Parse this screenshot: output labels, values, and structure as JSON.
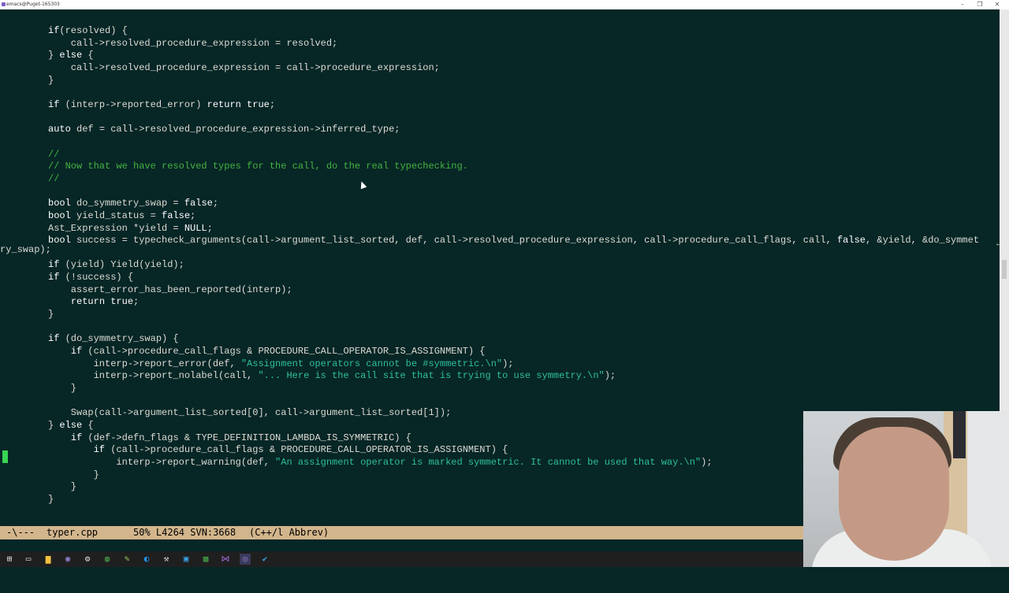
{
  "window": {
    "title": "emacs@Puget-165303",
    "controls": {
      "minimize": "–",
      "maximize": "❐",
      "close": "✕"
    }
  },
  "editor": {
    "code_lines": [
      [
        [
          "kw",
          "if"
        ],
        [
          "",
          "(resolved) {"
        ]
      ],
      [
        [
          "",
          "    call->resolved_procedure_expression = resolved;"
        ]
      ],
      [
        [
          "",
          "} "
        ],
        [
          "kw",
          "else"
        ],
        [
          "",
          " {"
        ]
      ],
      [
        [
          "",
          "    call->resolved_procedure_expression = call->procedure_expression;"
        ]
      ],
      [
        [
          "",
          "}"
        ]
      ],
      [
        [
          "",
          ""
        ]
      ],
      [
        [
          "kw",
          "if"
        ],
        [
          "",
          " (interp->reported_error) "
        ],
        [
          "kw",
          "return true"
        ],
        [
          "",
          ";"
        ]
      ],
      [
        [
          "",
          ""
        ]
      ],
      [
        [
          "kw",
          "auto"
        ],
        [
          "",
          " def = call->resolved_procedure_expression->inferred_type;"
        ]
      ],
      [
        [
          "",
          ""
        ]
      ],
      [
        [
          "cm",
          "//"
        ]
      ],
      [
        [
          "cm",
          "// Now that we have resolved types for the call, do the real typechecking."
        ]
      ],
      [
        [
          "cm",
          "//"
        ]
      ],
      [
        [
          "",
          ""
        ]
      ],
      [
        [
          "kw",
          "bool"
        ],
        [
          "",
          " do_symmetry_swap = "
        ],
        [
          "kw",
          "false"
        ],
        [
          "",
          ";"
        ]
      ],
      [
        [
          "kw",
          "bool"
        ],
        [
          "",
          " yield_status = "
        ],
        [
          "kw",
          "false"
        ],
        [
          "",
          ";"
        ]
      ],
      [
        [
          "",
          "Ast_Expression *yield = "
        ],
        [
          "kw",
          "NULL"
        ],
        [
          "",
          ";"
        ]
      ],
      [
        [
          "kw",
          "bool"
        ],
        [
          "",
          " success = typecheck_arguments(call->argument_list_sorted, def, call->resolved_procedure_expression, call->procedure_call_flags, call, "
        ],
        [
          "kw",
          "false"
        ],
        [
          "",
          ", &yield, &do_symmet"
        ]
      ],
      [
        [
          "",
          ""
        ]
      ],
      [
        [
          "kw",
          "if"
        ],
        [
          "",
          " (yield) Yield(yield);"
        ]
      ],
      [
        [
          "kw",
          "if"
        ],
        [
          "",
          " (!success) {"
        ]
      ],
      [
        [
          "",
          "    assert_error_has_been_reported(interp);"
        ]
      ],
      [
        [
          "",
          "    "
        ],
        [
          "kw",
          "return true"
        ],
        [
          "",
          ";"
        ]
      ],
      [
        [
          "",
          "}"
        ]
      ],
      [
        [
          "",
          ""
        ]
      ],
      [
        [
          "kw",
          "if"
        ],
        [
          "",
          " (do_symmetry_swap) {"
        ]
      ],
      [
        [
          "",
          "    "
        ],
        [
          "kw",
          "if"
        ],
        [
          "",
          " (call->procedure_call_flags & PROCEDURE_CALL_OPERATOR_IS_ASSIGNMENT) {"
        ]
      ],
      [
        [
          "",
          "        interp->report_error(def, "
        ],
        [
          "str",
          "\"Assignment operators cannot be #symmetric.\\n\""
        ],
        [
          "",
          ");"
        ]
      ],
      [
        [
          "",
          "        interp->report_nolabel(call, "
        ],
        [
          "str",
          "\"... Here is the call site that is trying to use symmetry.\\n\""
        ],
        [
          "",
          ");"
        ]
      ],
      [
        [
          "",
          "    }"
        ]
      ],
      [
        [
          "",
          ""
        ]
      ],
      [
        [
          "",
          "    Swap(call->argument_list_sorted[0], call->argument_list_sorted[1]);"
        ]
      ],
      [
        [
          "",
          "} "
        ],
        [
          "kw",
          "else"
        ],
        [
          "",
          " {"
        ]
      ],
      [
        [
          "",
          "    "
        ],
        [
          "kw",
          "if"
        ],
        [
          "",
          " (def->defn_flags & TYPE_DEFINITION_LAMBDA_IS_SYMMETRIC) {"
        ]
      ],
      [
        [
          "",
          "        "
        ],
        [
          "kw",
          "if"
        ],
        [
          "",
          " (call->procedure_call_flags & PROCEDURE_CALL_OPERATOR_IS_ASSIGNMENT) {"
        ]
      ],
      [
        [
          "",
          "            interp->report_warning(def, "
        ],
        [
          "str",
          "\"An assignment operator is marked symmetric. It cannot be used that way.\\n\""
        ],
        [
          "",
          ");"
        ]
      ],
      [
        [
          "",
          "        }"
        ]
      ],
      [
        [
          "",
          "    }"
        ]
      ],
      [
        [
          "",
          "}"
        ]
      ]
    ],
    "wrapped_line": "ry_swap);",
    "continuation_glyph": "↵"
  },
  "modeline": {
    "state": "-\\---",
    "buffer_name": "typer.cpp",
    "position": "50% L4264 SVN:3668",
    "modes": "(C++/l Abbrev)"
  },
  "taskbar": {
    "icons": [
      "windows-start-icon",
      "task-view-icon",
      "file-explorer-icon",
      "emacs-icon",
      "app-icon",
      "chrome-icon",
      "notepadpp-icon",
      "edge-icon",
      "tools-icon",
      "terminal-icon",
      "app-green-icon",
      "visual-studio-icon",
      "emacs-active-icon",
      "check-icon"
    ]
  },
  "colors": {
    "background": "#072626",
    "text": "#dcdcd4",
    "comment": "#44b340",
    "string": "#2ec09c",
    "modeline": "#d2b58c"
  }
}
